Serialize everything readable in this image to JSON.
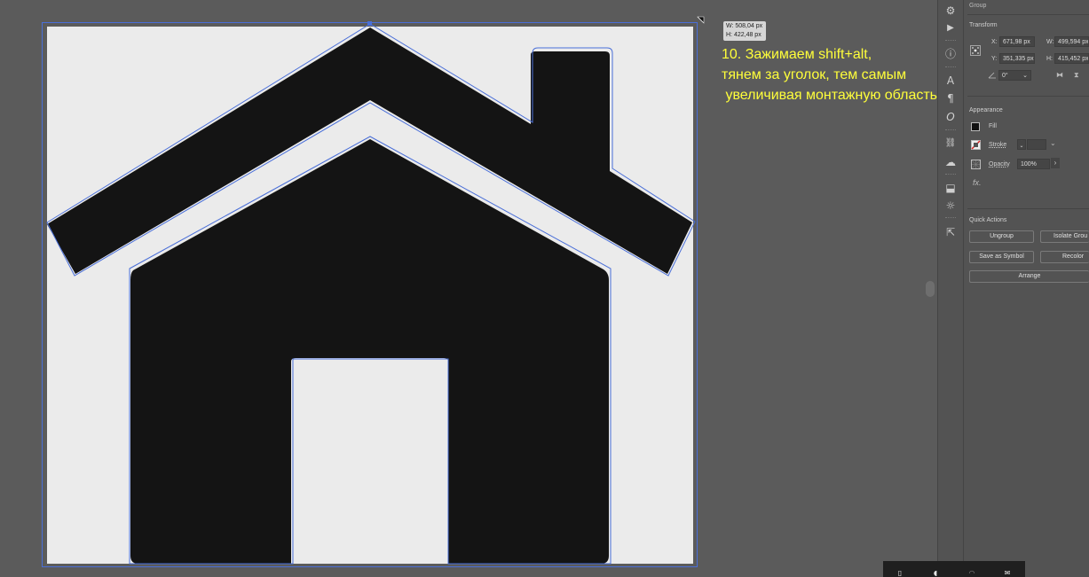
{
  "tooltip": {
    "width": "W: 508,04 px",
    "height": "H: 422,48 px"
  },
  "instruction": {
    "text": "10. Зажимаем shift+alt,\nтянем за уголок, тем самым\n увеличивая монтажную область."
  },
  "tools": [
    {
      "icon": "gear-icon",
      "glyph": "⚙"
    },
    {
      "icon": "play-icon",
      "glyph": "▶"
    },
    {
      "icon": "info-icon",
      "glyph": "ⓘ"
    },
    {
      "icon": "character-icon",
      "glyph": "A"
    },
    {
      "icon": "paragraph-icon",
      "glyph": "¶"
    },
    {
      "icon": "opentype-icon",
      "glyph": "O"
    },
    {
      "icon": "links-icon",
      "glyph": "⛓"
    },
    {
      "icon": "cc-libraries-icon",
      "glyph": "☁"
    },
    {
      "icon": "export-icon",
      "glyph": "⬓"
    },
    {
      "icon": "sun-icon",
      "glyph": "☼"
    },
    {
      "icon": "external-link-icon",
      "glyph": "⇱"
    }
  ],
  "panel": {
    "selection_type": "Group",
    "transform": {
      "title": "Transform",
      "x_label": "X:",
      "x_value": "671,98 px",
      "y_label": "Y:",
      "y_value": "351,335 px",
      "w_label": "W:",
      "w_value": "499,594 px",
      "h_label": "H:",
      "h_value": "415,452 px",
      "angle_value": "0°"
    },
    "appearance": {
      "title": "Appearance",
      "fill_label": "Fill",
      "stroke_label": "Stroke",
      "opacity_label": "Opacity",
      "opacity_value": "100%",
      "fx_label": "fx."
    },
    "quick_actions": {
      "title": "Quick Actions",
      "ungroup": "Ungroup",
      "isolate_group": "Isolate Grou",
      "save_as_symbol": "Save as Symbol",
      "recolor": "Recolor",
      "arrange": "Arrange"
    }
  },
  "colors": {
    "accent_selection": "#4a6fd8",
    "instruction_text": "#ffff3a",
    "artwork_fill": "#141414",
    "artboard": "#ebebeb",
    "workspace": "#5b5b5b"
  }
}
